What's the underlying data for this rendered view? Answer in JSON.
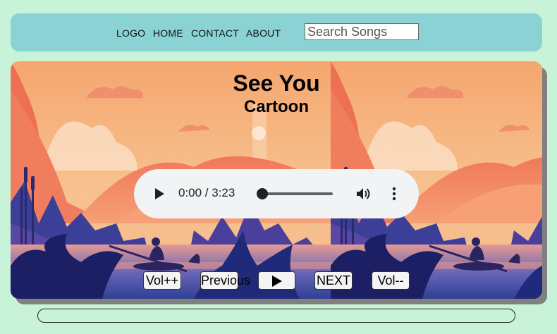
{
  "nav": {
    "logo": "LOGO",
    "home": "HOME",
    "contact": "CONTACT",
    "about": "ABOUT",
    "search_placeholder": "Search Songs"
  },
  "song": {
    "title": "See You",
    "artist": "Cartoon"
  },
  "audio": {
    "time": "0:00 / 3:23",
    "progress": 0
  },
  "controls": {
    "vol_up": "Vol++",
    "previous": "Previous",
    "next": "NEXT",
    "vol_down": "Vol--"
  },
  "song_progress": 0,
  "colors": {
    "background": "#c9f3d9",
    "navbar": "#8bd2d4",
    "shadow": "#808080"
  },
  "icons": [
    "play-icon",
    "volume-icon",
    "more-options-icon",
    "play-icon"
  ]
}
